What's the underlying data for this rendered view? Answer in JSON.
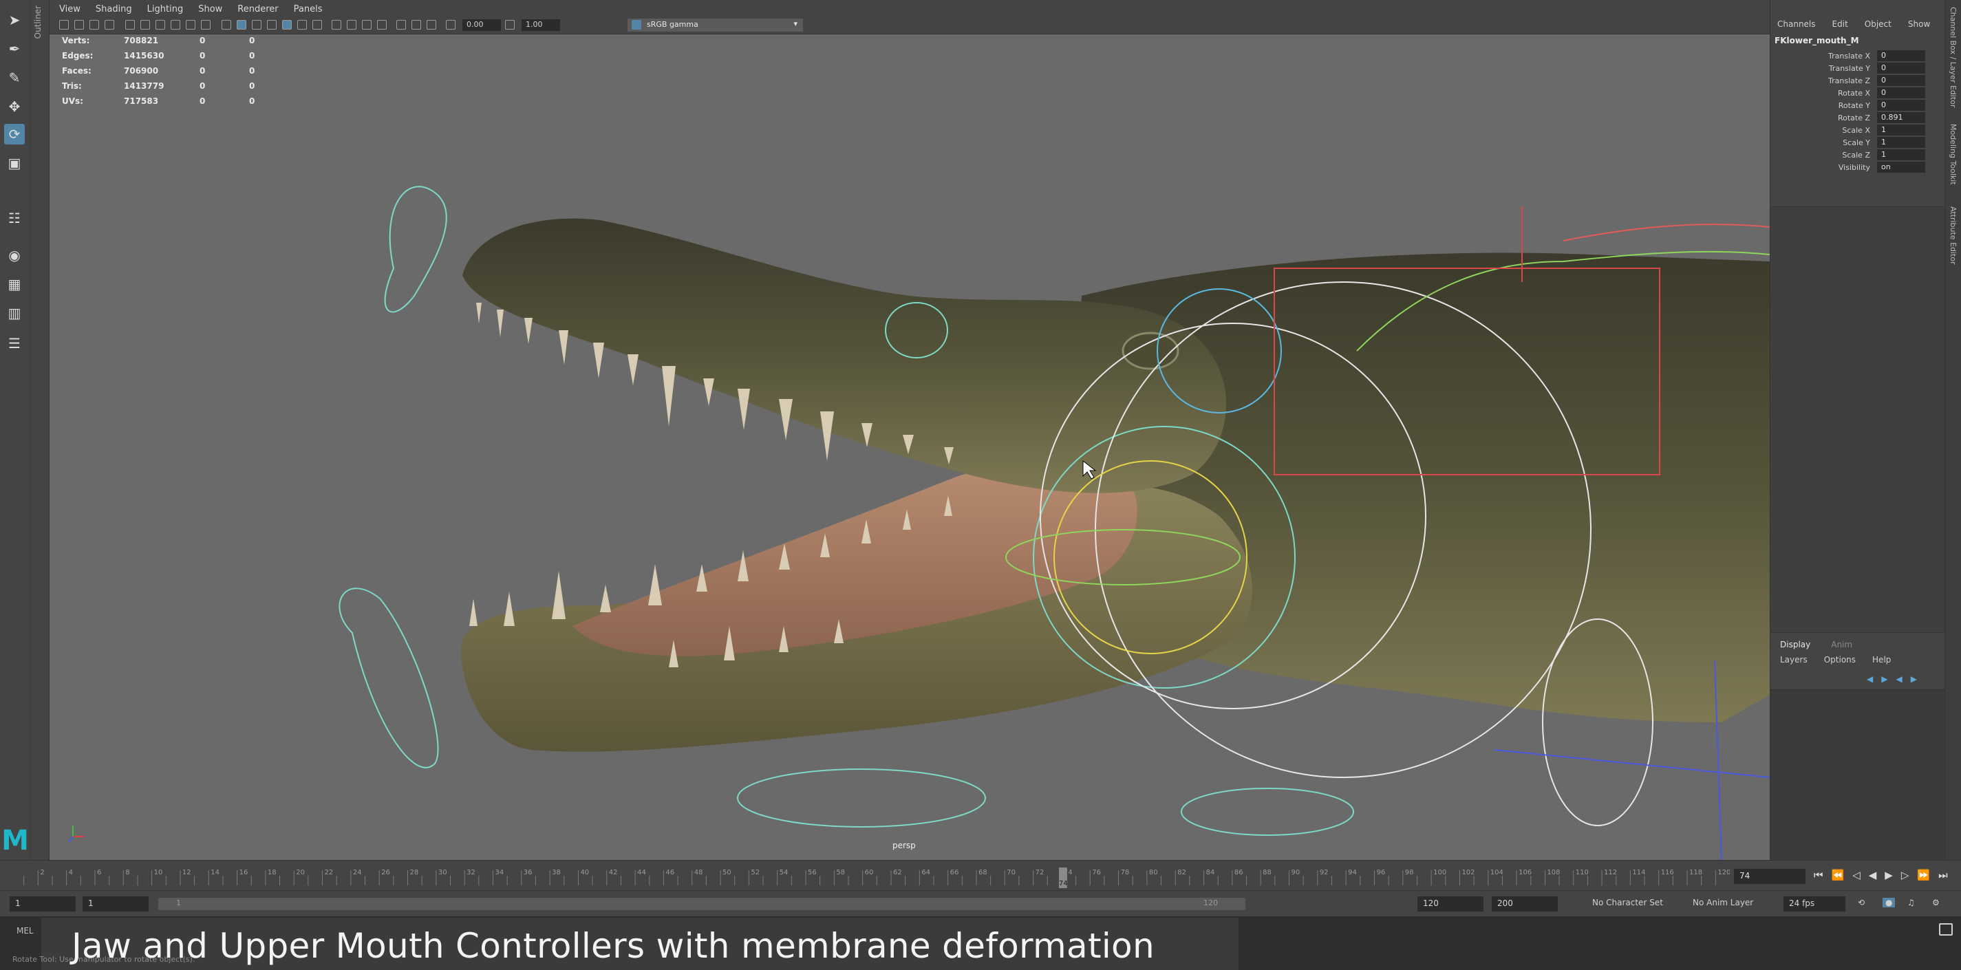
{
  "viewport": {
    "menu": [
      "View",
      "Shading",
      "Lighting",
      "Show",
      "Renderer",
      "Panels"
    ],
    "exposure": "0.00",
    "gamma": "1.00",
    "color_space": "sRGB gamma",
    "camera": "persp"
  },
  "hud": {
    "rows": [
      {
        "label": "Verts:",
        "value": "708821",
        "a": "0",
        "b": "0"
      },
      {
        "label": "Edges:",
        "value": "1415630",
        "a": "0",
        "b": "0"
      },
      {
        "label": "Faces:",
        "value": "706900",
        "a": "0",
        "b": "0"
      },
      {
        "label": "Tris:",
        "value": "1413779",
        "a": "0",
        "b": "0"
      },
      {
        "label": "UVs:",
        "value": "717583",
        "a": "0",
        "b": "0"
      }
    ]
  },
  "outliner_tab": "Outliner",
  "channel_box": {
    "menu": [
      "Channels",
      "Edit",
      "Object",
      "Show"
    ],
    "node": "FKlower_mouth_M",
    "attributes": [
      {
        "label": "Translate X",
        "value": "0"
      },
      {
        "label": "Translate Y",
        "value": "0"
      },
      {
        "label": "Translate Z",
        "value": "0"
      },
      {
        "label": "Rotate X",
        "value": "0"
      },
      {
        "label": "Rotate Y",
        "value": "0"
      },
      {
        "label": "Rotate Z",
        "value": "0.891"
      },
      {
        "label": "Scale X",
        "value": "1"
      },
      {
        "label": "Scale Y",
        "value": "1"
      },
      {
        "label": "Scale Z",
        "value": "1"
      },
      {
        "label": "Visibility",
        "value": "on"
      }
    ]
  },
  "layer_editor": {
    "tabs": [
      "Display",
      "Anim"
    ],
    "menu": [
      "Layers",
      "Options",
      "Help"
    ]
  },
  "side_tabs": [
    "Channel Box / Layer Editor",
    "Modeling Toolkit",
    "Attribute Editor"
  ],
  "timeline": {
    "ticks": [
      "2",
      "4",
      "6",
      "8",
      "10",
      "12",
      "14",
      "16",
      "18",
      "20",
      "22",
      "24",
      "26",
      "28",
      "30",
      "32",
      "34",
      "36",
      "38",
      "40",
      "42",
      "44",
      "46",
      "48",
      "50",
      "52",
      "54",
      "56",
      "58",
      "60",
      "62",
      "64",
      "66",
      "68",
      "70",
      "72",
      "74",
      "76",
      "78",
      "80",
      "82",
      "84",
      "86",
      "88",
      "90",
      "92",
      "94",
      "96",
      "98",
      "100",
      "102",
      "104",
      "106",
      "108",
      "110",
      "112",
      "114",
      "116",
      "118",
      "120"
    ],
    "current_frame": "74",
    "playhead_label": "74"
  },
  "range": {
    "start": "1",
    "inner_start": "1",
    "inner_start_label": "1",
    "inner_end_label": "120",
    "inner_end": "120",
    "end": "200",
    "character_set": "No Character Set",
    "anim_layer": "No Anim Layer",
    "fps": "24 fps"
  },
  "command": {
    "mel_label": "MEL",
    "help_text": "Rotate Tool: Use manipulator to rotate object(s)."
  },
  "caption": "Jaw and Upper Mouth Controllers with membrane deformation",
  "colors": {
    "accent": "#5285a6",
    "maya_logo": "#1fb7c9",
    "viewport_bg": "#6a6a6a"
  }
}
